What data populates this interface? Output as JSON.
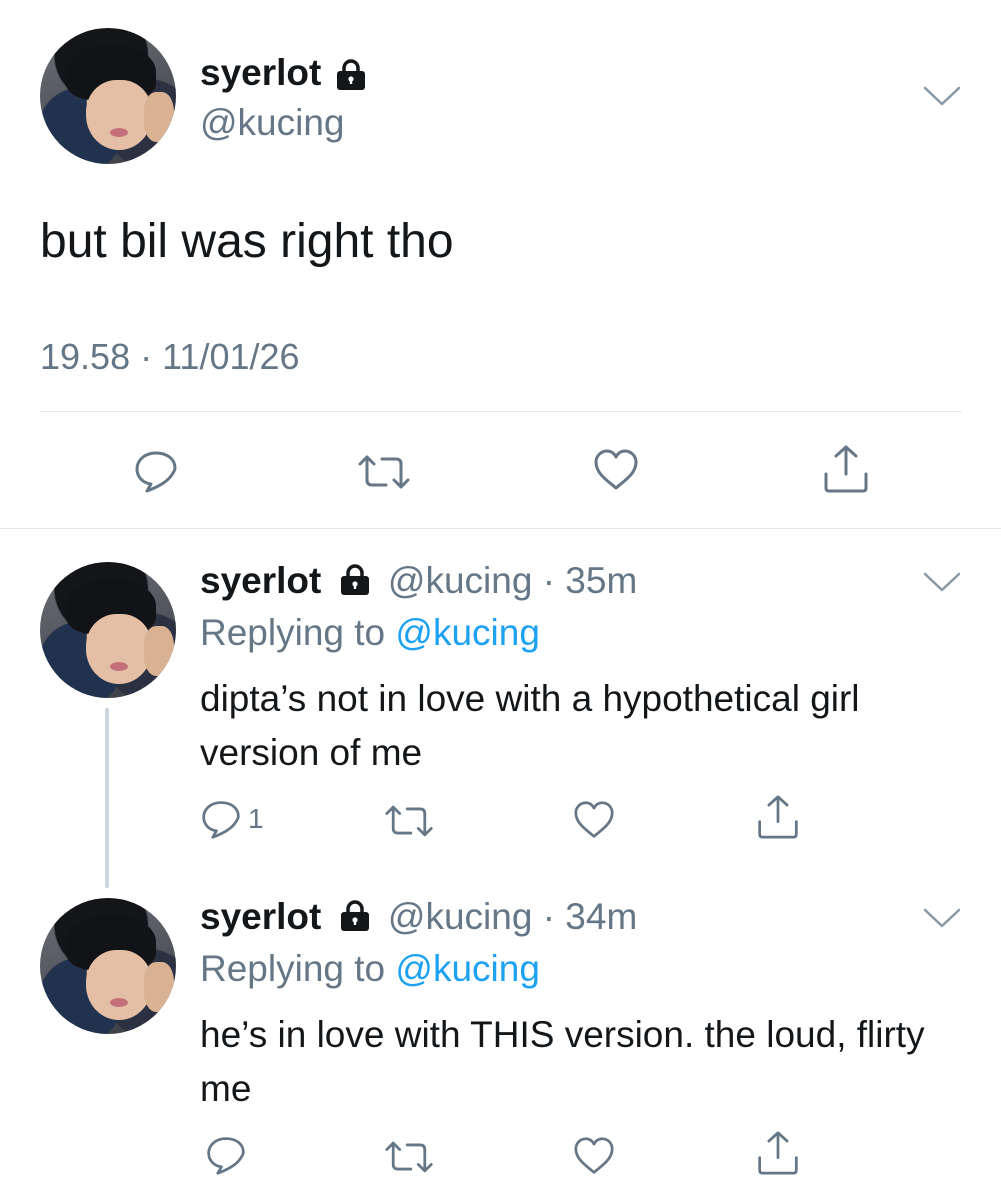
{
  "main_tweet": {
    "display_name": "syerlot",
    "handle": "@kucing",
    "text": "but bil was right tho",
    "timestamp": "19.58 · 11/01/26"
  },
  "replies": [
    {
      "display_name": "syerlot",
      "handle": "@kucing",
      "time": "· 35m",
      "replying_prefix": "Replying to ",
      "replying_to": "@kucing",
      "text": "dipta’s not in love with a hypothetical girl version of me",
      "reply_count": "1"
    },
    {
      "display_name": "syerlot",
      "handle": "@kucing",
      "time": "· 34m",
      "replying_prefix": "Replying to ",
      "replying_to": "@kucing",
      "text": "he’s in love with THIS version. the loud, flirty me",
      "reply_count": ""
    }
  ],
  "icons": {
    "reply": "speech-bubble-icon",
    "retweet": "retweet-icon",
    "like": "heart-icon",
    "share": "share-icon",
    "lock": "lock-icon",
    "menu": "chevron-down-icon"
  },
  "colors": {
    "text": "#14171a",
    "secondary": "#657786",
    "link": "#1da1f2",
    "divider": "#e1e8ed"
  }
}
